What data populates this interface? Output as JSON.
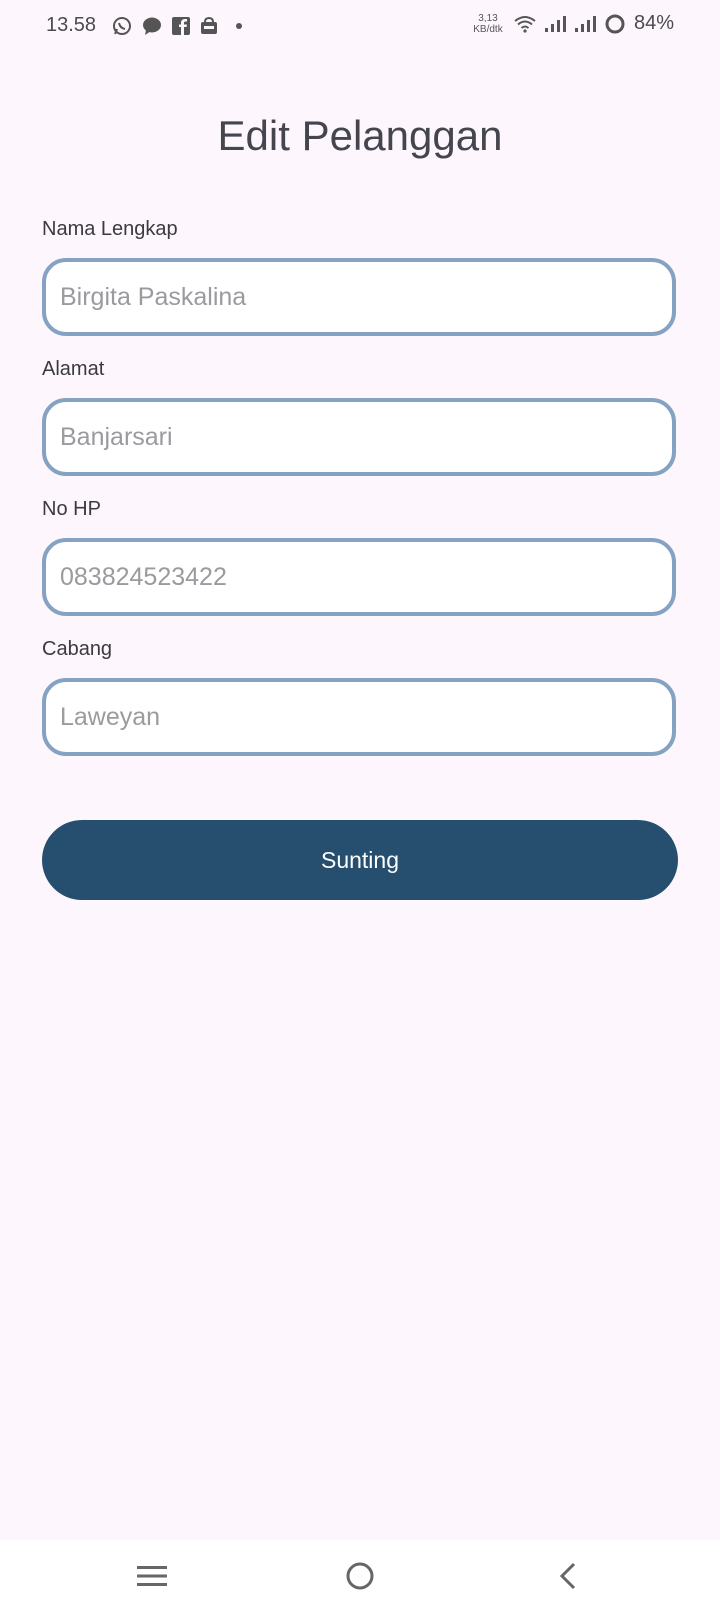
{
  "status_bar": {
    "time": "13.58",
    "net_speed_value": "3,13",
    "net_speed_unit": "KB/dtk",
    "battery": "84%"
  },
  "page": {
    "title": "Edit Pelanggan"
  },
  "form": {
    "fields": [
      {
        "label": "Nama Lengkap",
        "placeholder": "Birgita Paskalina"
      },
      {
        "label": "Alamat",
        "placeholder": "Banjarsari"
      },
      {
        "label": "No HP",
        "placeholder": "083824523422"
      },
      {
        "label": "Cabang",
        "placeholder": "Laweyan"
      }
    ],
    "submit_label": "Sunting"
  },
  "colors": {
    "background": "#fdf7fd",
    "input_border": "#86a2c2",
    "button": "#264e6f"
  },
  "icons": {
    "status_left": [
      "whatsapp-icon",
      "chat-bubble-icon",
      "facebook-icon",
      "shopping-bag-icon",
      "notification-dot-icon"
    ],
    "status_right": [
      "wifi-icon",
      "signal-icon",
      "signal-icon",
      "battery-ring-icon"
    ],
    "nav": [
      "menu-icon",
      "home-icon",
      "back-icon"
    ]
  }
}
